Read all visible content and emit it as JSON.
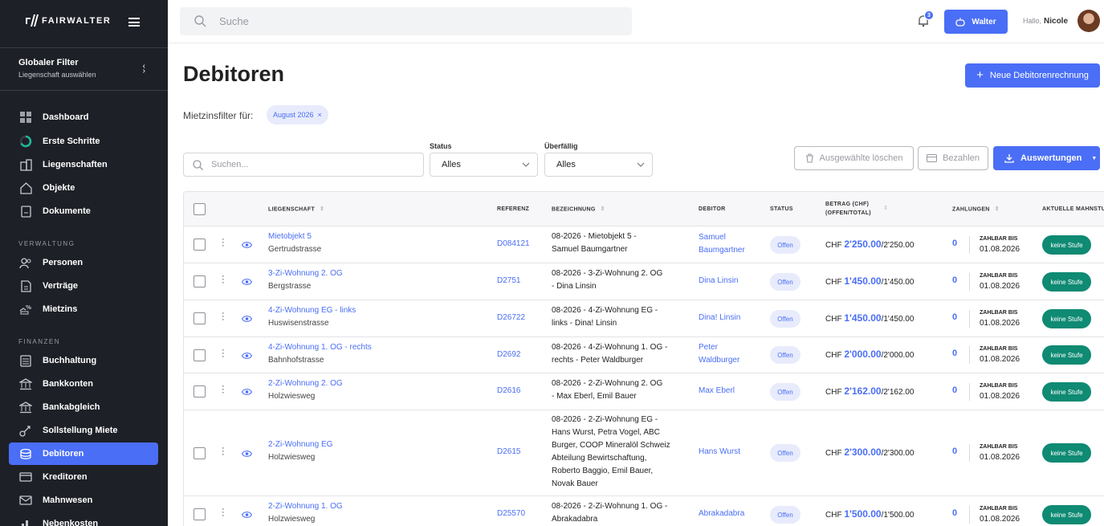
{
  "sidebar": {
    "logo": "FAIRWALTER",
    "global_filter": {
      "title": "Globaler Filter",
      "subtitle": "Liegenschaft auswählen"
    },
    "items": [
      {
        "label": "Dashboard",
        "icon": "grid-icon"
      },
      {
        "label": "Erste Schritte",
        "icon": "progress-ring-icon"
      },
      {
        "label": "Liegenschaften",
        "icon": "buildings-icon"
      },
      {
        "label": "Objekte",
        "icon": "house-icon"
      },
      {
        "label": "Dokumente",
        "icon": "document-icon"
      }
    ],
    "section_verwaltung": "VERWALTUNG",
    "verwaltung_items": [
      {
        "label": "Personen",
        "icon": "people-icon"
      },
      {
        "label": "Verträge",
        "icon": "contract-icon"
      },
      {
        "label": "Mietzins",
        "icon": "rent-percent-icon"
      }
    ],
    "section_finanzen": "FINANZEN",
    "finanzen_items": [
      {
        "label": "Buchhaltung",
        "icon": "calculator-icon"
      },
      {
        "label": "Bankkonten",
        "icon": "bank-icon"
      },
      {
        "label": "Bankabgleich",
        "icon": "bank-sync-icon"
      },
      {
        "label": "Sollstellung Miete",
        "icon": "target-icon"
      },
      {
        "label": "Debitoren",
        "icon": "coins-icon",
        "active": true
      },
      {
        "label": "Kreditoren",
        "icon": "card-icon"
      },
      {
        "label": "Mahnwesen",
        "icon": "mail-icon"
      },
      {
        "label": "Nebenkosten",
        "icon": "chart-icon"
      }
    ]
  },
  "topbar": {
    "search_placeholder": "Suche",
    "notification_count": "3",
    "walter_button": "Walter",
    "greeting": "Hallo,",
    "user_name": "Nicole"
  },
  "page": {
    "title": "Debitoren",
    "new_button": "Neue Debitorenrechnung",
    "mietzins_label": "Mietzinsfilter für:",
    "mietzins_chip": "August 2026",
    "search_placeholder": "Suchen...",
    "status_label": "Status",
    "status_value": "Alles",
    "overdue_label": "Überfällig",
    "overdue_value": "Alles",
    "delete_button": "Ausgewählte löschen",
    "pay_button": "Bezahlen",
    "reports_button": "Auswertungen"
  },
  "table": {
    "headers": {
      "liegenschaft": "LIEGENSCHAFT",
      "referenz": "REFERENZ",
      "bezeichnung": "BEZEICHNUNG",
      "debitor": "DEBITOR",
      "status": "STATUS",
      "betrag_1": "BETRAG (CHF)",
      "betrag_2": "(OFFEN/TOTAL)",
      "zahlungen": "ZAHLUNGEN",
      "mahnstufe": "AKTUELLE MAHNSTUFE"
    },
    "rows": [
      {
        "objekt": "Mietobjekt 5",
        "strasse": "Gertrudstrasse",
        "referenz": "D084121",
        "bez1": "08-2026 - Mietobjekt 5 -",
        "bez2": "Samuel Baumgartner",
        "deb1": "Samuel",
        "deb2": "Baumgartner",
        "status": "Offen",
        "chf": "CHF",
        "offen": "2'250.00",
        "total": "/2'250.00",
        "zahlungen": "0",
        "zb_label": "ZAHLBAR BIS",
        "zb_date": "01.08.2026",
        "stufe": "keine Stufe"
      },
      {
        "objekt": "3-Zi-Wohnung 2. OG",
        "strasse": "Bergstrasse",
        "referenz": "D2751",
        "bez1": "08-2026 - 3-Zi-Wohnung 2. OG",
        "bez2": "- Dina Linsin",
        "deb1": "Dina Linsin",
        "deb2": "",
        "status": "Offen",
        "chf": "CHF",
        "offen": "1'450.00",
        "total": "/1'450.00",
        "zahlungen": "0",
        "zb_label": "ZAHLBAR BIS",
        "zb_date": "01.08.2026",
        "stufe": "keine Stufe"
      },
      {
        "objekt": "4-Zi-Wohnung EG - links",
        "strasse": "Huswisenstrasse",
        "referenz": "D26722",
        "bez1": "08-2026 - 4-Zi-Wohnung EG -",
        "bez2": "links - Dina! Linsin",
        "deb1": "Dina! Linsin",
        "deb2": "",
        "status": "Offen",
        "chf": "CHF",
        "offen": "1'450.00",
        "total": "/1'450.00",
        "zahlungen": "0",
        "zb_label": "ZAHLBAR BIS",
        "zb_date": "01.08.2026",
        "stufe": "keine Stufe"
      },
      {
        "objekt": "4-Zi-Wohnung 1. OG - rechts",
        "strasse": "Bahnhofstrasse",
        "referenz": "D2692",
        "bez1": "08-2026 - 4-Zi-Wohnung 1. OG -",
        "bez2": "rechts - Peter Waldburger",
        "deb1": "Peter",
        "deb2": "Waldburger",
        "status": "Offen",
        "chf": "CHF",
        "offen": "2'000.00",
        "total": "/2'000.00",
        "zahlungen": "0",
        "zb_label": "ZAHLBAR BIS",
        "zb_date": "01.08.2026",
        "stufe": "keine Stufe"
      },
      {
        "objekt": "2-Zi-Wohnung 2. OG",
        "strasse": "Holzwiesweg",
        "referenz": "D2616",
        "bez1": "08-2026 - 2-Zi-Wohnung 2. OG",
        "bez2": "- Max Eberl, Emil Bauer",
        "deb1": "Max Eberl",
        "deb2": "",
        "status": "Offen",
        "chf": "CHF",
        "offen": "2'162.00",
        "total": "/2'162.00",
        "zahlungen": "0",
        "zb_label": "ZAHLBAR BIS",
        "zb_date": "01.08.2026",
        "stufe": "keine Stufe"
      },
      {
        "objekt": "2-Zi-Wohnung EG",
        "strasse": "Holzwiesweg",
        "referenz": "D2615",
        "bez_lines": [
          "08-2026 - 2-Zi-Wohnung EG -",
          "Hans Wurst, Petra Vogel, ABC",
          "Burger, COOP Mineralöl Schweiz",
          "Abteilung Bewirtschaftung,",
          "Roberto Baggio, Emil Bauer,",
          "Novak Bauer"
        ],
        "deb1": "Hans Wurst",
        "deb2": "",
        "status": "Offen",
        "chf": "CHF",
        "offen": "2'300.00",
        "total": "/2'300.00",
        "zahlungen": "0",
        "zb_label": "ZAHLBAR BIS",
        "zb_date": "01.08.2026",
        "stufe": "keine Stufe"
      },
      {
        "objekt": "2-Zi-Wohnung 1. OG",
        "strasse": "Holzwiesweg",
        "referenz": "D25570",
        "bez1": "08-2026 - 2-Zi-Wohnung 1. OG -",
        "bez2": "Abrakadabra",
        "deb1": "Abrakadabra",
        "deb2": "",
        "status": "Offen",
        "chf": "CHF",
        "offen": "1'500.00",
        "total": "/1'500.00",
        "zahlungen": "0",
        "zb_label": "ZAHLBAR BIS",
        "zb_date": "01.08.2026",
        "stufe": "keine Stufe"
      }
    ]
  },
  "colors": {
    "accent": "#4a6ef5",
    "sidebar": "#1e2027",
    "stufe": "#0f8a73"
  }
}
